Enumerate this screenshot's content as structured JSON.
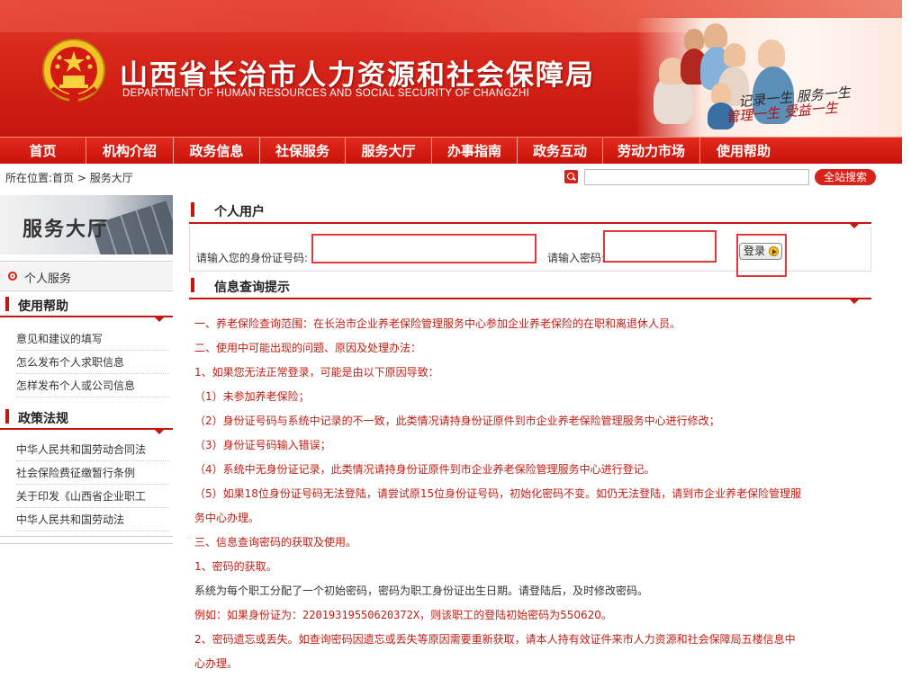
{
  "header": {
    "title": "山西省长治市人力资源和社会保障局",
    "subtitle": "DEPARTMENT OF HUMAN RESOURCES AND SOCIAL SECURITY OF CHANGZHI",
    "slogan_line1": "记录一生 服务一生",
    "slogan_line2": "管理一生 受益一生"
  },
  "nav": {
    "items": [
      "首页",
      "机构介绍",
      "政务信息",
      "社保服务",
      "服务大厅",
      "办事指南",
      "政务互动",
      "劳动力市场",
      "使用帮助"
    ]
  },
  "location": {
    "text": "所在位置:首页 > 服务大厅",
    "search_button": "全站搜索",
    "search_value": ""
  },
  "sidebar": {
    "banner_title": "服务大厅",
    "personal_service": "个人服务",
    "help": {
      "title": "使用帮助",
      "links": [
        "意见和建议的填写",
        "怎么发布个人求职信息",
        "怎样发布个人或公司信息"
      ]
    },
    "policy": {
      "title": "政策法规",
      "links": [
        "中华人民共和国劳动合同法",
        "社会保险费征缴暂行条例",
        "关于印发《山西省企业职工",
        "中华人民共和国劳动法"
      ]
    }
  },
  "main": {
    "login": {
      "section_title": "个人用户",
      "id_label": "请输入您的身份证号码:",
      "id_value": "",
      "password_label": "请输入密码:",
      "password_value": "",
      "login_button": "登录"
    },
    "info": {
      "section_title": "信息查询提示",
      "lines": [
        "一、养老保险查询范围：在长治市企业养老保险管理服务中心参加企业养老保险的在职和离退休人员。",
        "二、使用中可能出现的问题、原因及处理办法：",
        "1、如果您无法正常登录，可能是由以下原因导致：",
        "（1）未参加养老保险；",
        "（2）身份证号码与系统中记录的不一致，此类情况请持身份证原件到市企业养老保险管理服务中心进行修改；",
        "（3）身份证号码输入错误；",
        "（4）系统中无身份证记录，此类情况请持身份证原件到市企业养老保险管理服务中心进行登记。",
        "（5）如果18位身份证号码无法登陆，请尝试原15位身份证号码，初始化密码不变。如仍无法登陆，请到市企业养老保险管理服",
        "务中心办理。",
        "三、信息查询密码的获取及使用。",
        "1、密码的获取。"
      ],
      "dark_line": "系统为每个职工分配了一个初始密码，密码为职工身份证出生日期。请登陆后，及时修改密码。",
      "example_prefix": "例如：如果身份证为：",
      "example_id": "22019319550620372X",
      "example_suffix": "，则该职工的登陆初始密码为550620。",
      "tail_lines": [
        "2、密码遗忘或丢失。如查询密码因遗忘或丢失等原因需要重新获取，请本人持有效证件来市人力资源和社会保障局五楼信息中",
        "心办理。"
      ]
    }
  },
  "colors": {
    "brand_red": "#c8160e",
    "highlight_red": "#e23a3a",
    "text_red": "#c21d12"
  }
}
